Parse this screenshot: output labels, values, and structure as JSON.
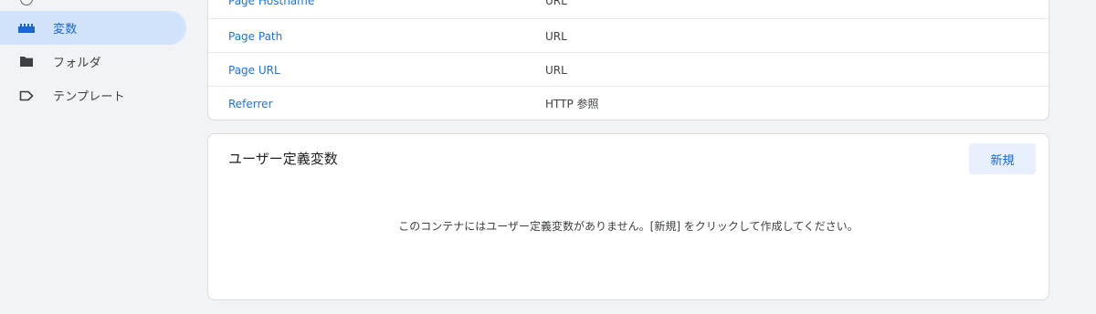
{
  "sidebar": {
    "items": [
      {
        "label": "変数",
        "icon": "variables-icon",
        "active": true
      },
      {
        "label": "フォルダ",
        "icon": "folder-icon",
        "active": false
      },
      {
        "label": "テンプレート",
        "icon": "label-outline-icon",
        "active": false
      }
    ]
  },
  "builtin_variables": {
    "rows": [
      {
        "name": "Page Hostname",
        "type": "URL"
      },
      {
        "name": "Page Path",
        "type": "URL"
      },
      {
        "name": "Page URL",
        "type": "URL"
      },
      {
        "name": "Referrer",
        "type": "HTTP 参照"
      }
    ]
  },
  "user_variables": {
    "title": "ユーザー定義変数",
    "new_button_label": "新規",
    "empty_message": "このコンテナにはユーザー定義変数がありません。[新規] をクリックして作成してください。"
  },
  "colors": {
    "accent": "#1a73e8",
    "active_bg": "#d2e3fc",
    "page_bg": "#f1f3f4"
  }
}
